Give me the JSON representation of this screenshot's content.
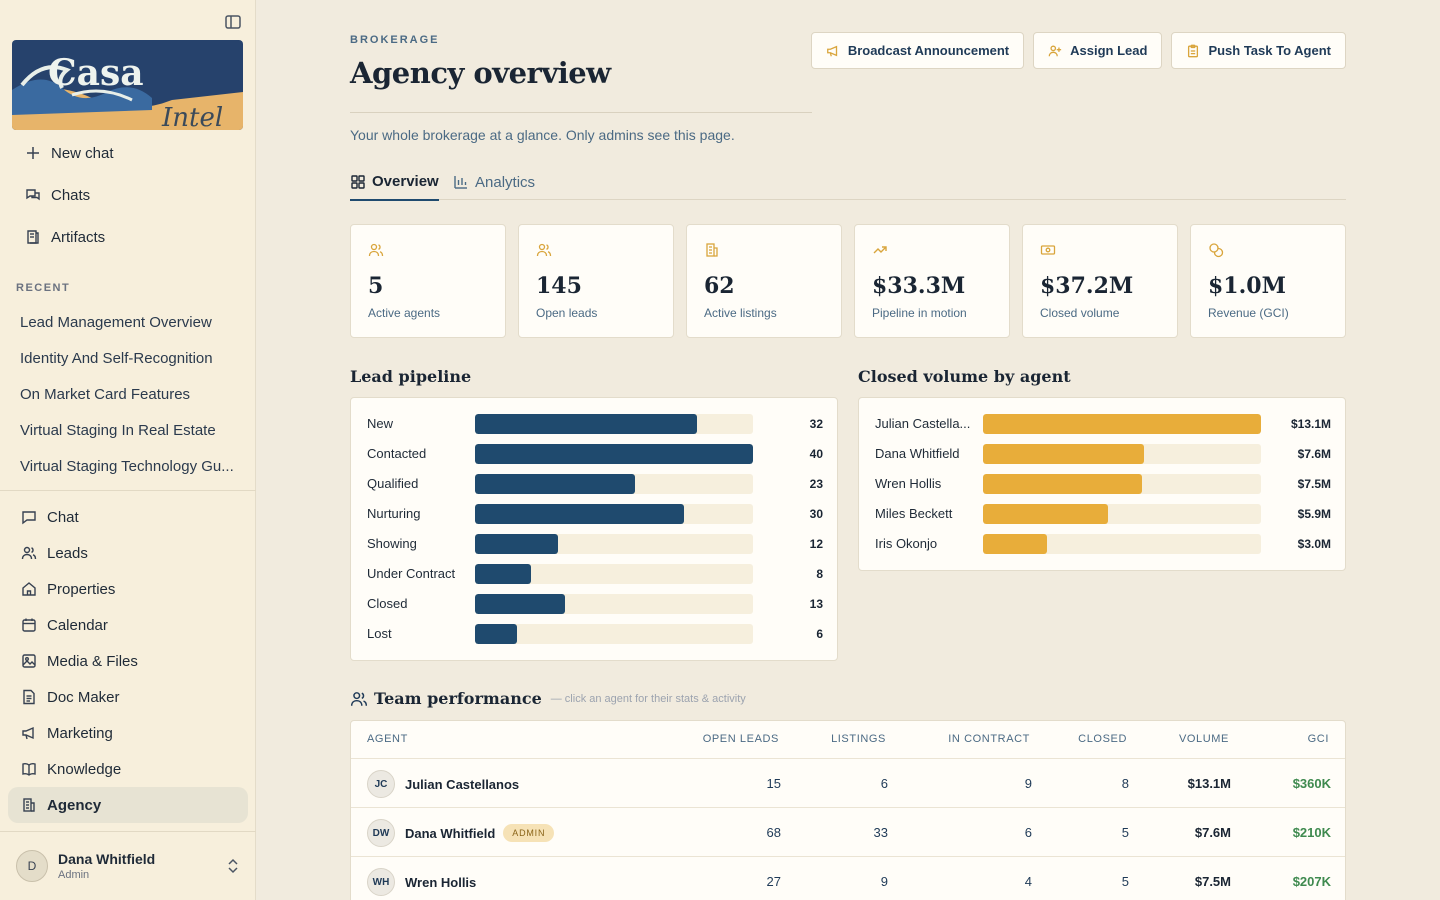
{
  "sidebar": {
    "logo_text_1": "Casa",
    "logo_text_2": "Intel",
    "top": [
      {
        "label": "New chat",
        "icon": "plus-icon"
      },
      {
        "label": "Chats",
        "icon": "chats-icon"
      },
      {
        "label": "Artifacts",
        "icon": "artifacts-icon"
      }
    ],
    "recent_heading": "RECENT",
    "recent": [
      "Lead Management Overview",
      "Identity And Self-Recognition",
      "On Market Card Features",
      "Virtual Staging In Real Estate",
      "Virtual Staging Technology Gu..."
    ],
    "nav": [
      {
        "label": "Chat",
        "icon": "chat-icon"
      },
      {
        "label": "Leads",
        "icon": "users-icon"
      },
      {
        "label": "Properties",
        "icon": "home-icon"
      },
      {
        "label": "Calendar",
        "icon": "calendar-icon"
      },
      {
        "label": "Media & Files",
        "icon": "image-icon"
      },
      {
        "label": "Doc Maker",
        "icon": "document-icon"
      },
      {
        "label": "Marketing",
        "icon": "megaphone-icon"
      },
      {
        "label": "Knowledge",
        "icon": "book-icon"
      },
      {
        "label": "Agency",
        "icon": "building-icon"
      }
    ],
    "active_nav": "Agency",
    "user": {
      "initial": "D",
      "name": "Dana Whitfield",
      "role": "Admin"
    }
  },
  "header": {
    "eyebrow": "BROKERAGE",
    "title": "Agency overview",
    "subtitle": "Your whole brokerage at a glance. Only admins see this page.",
    "actions": [
      "Broadcast Announcement",
      "Assign Lead",
      "Push Task To Agent"
    ]
  },
  "tabs": [
    "Overview",
    "Analytics"
  ],
  "stats": [
    {
      "value": "5",
      "label": "Active agents",
      "icon": "users-icon"
    },
    {
      "value": "145",
      "label": "Open leads",
      "icon": "users-icon"
    },
    {
      "value": "62",
      "label": "Active listings",
      "icon": "building-icon"
    },
    {
      "value": "$33.3M",
      "label": "Pipeline in motion",
      "icon": "trending-up-icon"
    },
    {
      "value": "$37.2M",
      "label": "Closed volume",
      "icon": "banknote-icon"
    },
    {
      "value": "$1.0M",
      "label": "Revenue (GCI)",
      "icon": "coins-icon"
    }
  ],
  "lead_pipeline": {
    "title": "Lead pipeline",
    "color": "#1f4a6e",
    "max": 40,
    "rows": [
      {
        "label": "New",
        "value": 32
      },
      {
        "label": "Contacted",
        "value": 40
      },
      {
        "label": "Qualified",
        "value": 23
      },
      {
        "label": "Nurturing",
        "value": 30
      },
      {
        "label": "Showing",
        "value": 12
      },
      {
        "label": "Under Contract",
        "value": 8
      },
      {
        "label": "Closed",
        "value": 13
      },
      {
        "label": "Lost",
        "value": 6
      }
    ]
  },
  "closed_volume": {
    "title": "Closed volume by agent",
    "color": "#e8ad3a",
    "max": 13.1,
    "rows": [
      {
        "label": "Julian Castella...",
        "value": 13.1,
        "display": "$13.1M"
      },
      {
        "label": "Dana Whitfield",
        "value": 7.6,
        "display": "$7.6M"
      },
      {
        "label": "Wren Hollis",
        "value": 7.5,
        "display": "$7.5M"
      },
      {
        "label": "Miles Beckett",
        "value": 5.9,
        "display": "$5.9M"
      },
      {
        "label": "Iris Okonjo",
        "value": 3.0,
        "display": "$3.0M"
      }
    ]
  },
  "team": {
    "title": "Team performance",
    "hint": "— click an agent for their stats & activity",
    "columns": [
      "AGENT",
      "OPEN LEADS",
      "LISTINGS",
      "IN CONTRACT",
      "CLOSED",
      "VOLUME",
      "GCI"
    ],
    "rows": [
      {
        "initials": "JC",
        "name": "Julian Castellanos",
        "badge": "",
        "open": "15",
        "listings": "6",
        "contract": "9",
        "closed": "8",
        "volume": "$13.1M",
        "gci": "$360K"
      },
      {
        "initials": "DW",
        "name": "Dana Whitfield",
        "badge": "ADMIN",
        "open": "68",
        "listings": "33",
        "contract": "6",
        "closed": "5",
        "volume": "$7.6M",
        "gci": "$210K"
      },
      {
        "initials": "WH",
        "name": "Wren Hollis",
        "badge": "",
        "open": "27",
        "listings": "9",
        "contract": "4",
        "closed": "5",
        "volume": "$7.5M",
        "gci": "$207K"
      }
    ],
    "gci_color": "#3f8a4f"
  }
}
